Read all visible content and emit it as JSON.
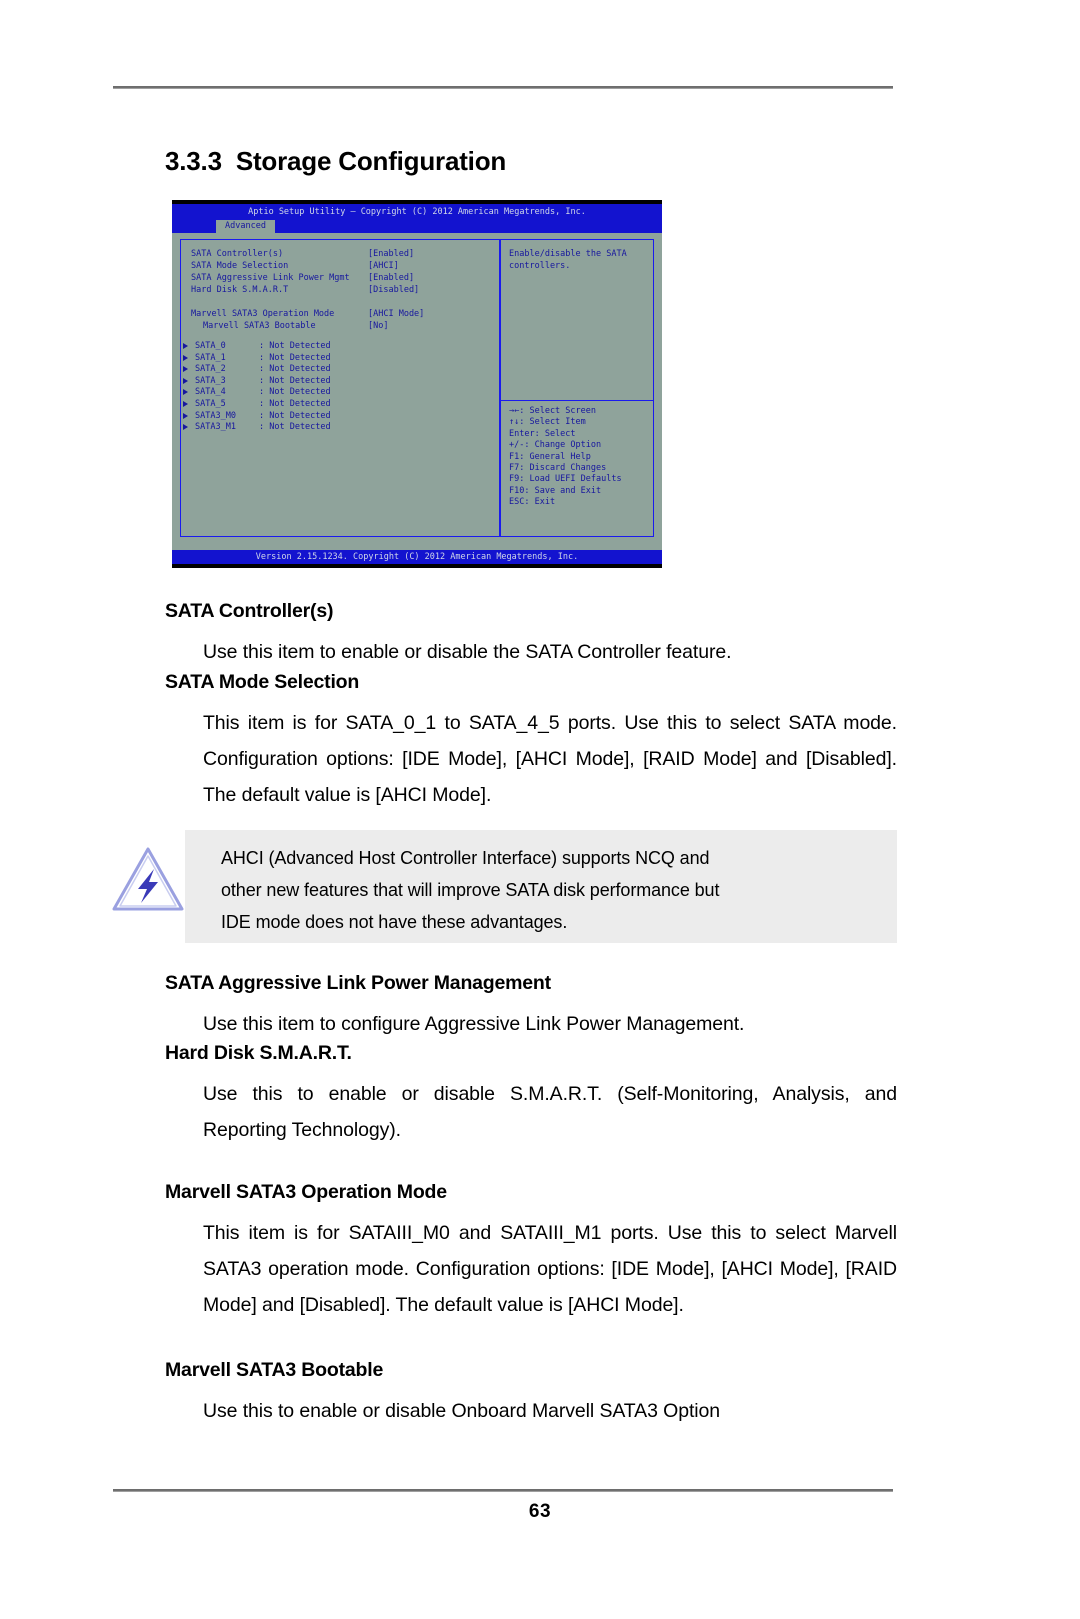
{
  "document": {
    "page_number": "63",
    "section_number": "3.3.3",
    "section_title": "Storage Configuration"
  },
  "bios": {
    "title": "Aptio Setup Utility – Copyright (C) 2012 American Megatrends, Inc.",
    "tab": "Advanced",
    "footer": "Version 2.15.1234. Copyright (C) 2012 American Megatrends, Inc.",
    "settings": [
      {
        "label": "SATA Controller(s)",
        "value": "[Enabled]",
        "indent": false
      },
      {
        "label": "SATA Mode Selection",
        "value": "[AHCI]",
        "indent": false
      },
      {
        "label": "SATA Aggressive Link Power Mgmt",
        "value": "[Enabled]",
        "indent": false
      },
      {
        "label": "Hard Disk S.M.A.R.T",
        "value": "[Disabled]",
        "indent": false
      },
      {
        "label": "Marvell SATA3 Operation Mode",
        "value": "[AHCI Mode]",
        "indent": false
      },
      {
        "label": "Marvell SATA3 Bootable",
        "value": "[No]",
        "indent": true
      }
    ],
    "devices": [
      {
        "name": "SATA_0",
        "status": ": Not Detected"
      },
      {
        "name": "SATA_1",
        "status": ": Not Detected"
      },
      {
        "name": "SATA_2",
        "status": ": Not Detected"
      },
      {
        "name": "SATA_3",
        "status": ": Not Detected"
      },
      {
        "name": "SATA_4",
        "status": ": Not Detected"
      },
      {
        "name": "SATA_5",
        "status": ": Not Detected"
      },
      {
        "name": "SATA3_M0",
        "status": ": Not Detected"
      },
      {
        "name": "SATA3_M1",
        "status": ": Not Detected"
      }
    ],
    "help": "Enable/disable the SATA controllers.",
    "keys": [
      "→←: Select Screen",
      "↑↓: Select Item",
      "Enter: Select",
      "+/-: Change Option",
      "F1: General Help",
      "F7: Discard Changes",
      "F9: Load UEFI Defaults",
      "F10: Save and Exit",
      "ESC: Exit"
    ]
  },
  "content": {
    "sata_controllers": {
      "term": "SATA Controller(s)",
      "body": "Use this item to enable or disable the SATA Controller feature."
    },
    "sata_mode_selection": {
      "term": "SATA Mode Selection",
      "body": "This item is for SATA_0_1 to SATA_4_5 ports. Use this to select SATA mode. Configuration options: [IDE Mode], [AHCI Mode], [RAID Mode] and [Disabled]. The default value is [AHCI Mode]."
    },
    "note": {
      "line1": "AHCI (Advanced Host Controller Interface) supports NCQ and",
      "line2": "other new features that will improve SATA disk performance but",
      "line3": "IDE mode does not have these advantages."
    },
    "sata_alpm": {
      "term": "SATA Aggressive Link Power Management",
      "body": "Use this item to configure Aggressive Link Power Management."
    },
    "hard_disk_smart": {
      "term": "Hard Disk S.M.A.R.T.",
      "body": "Use this to enable or disable S.M.A.R.T. (Self-Monitoring, Analysis, and Reporting Technology)."
    },
    "marvell_operation_mode": {
      "term": "Marvell SATA3 Operation Mode",
      "body": "This item is for SATAIII_M0 and SATAIII_M1 ports. Use this to select Marvell SATA3 operation mode. Configuration options: [IDE Mode], [AHCI Mode], [RAID Mode] and [Disabled]. The default value is [AHCI Mode]."
    },
    "marvell_bootable": {
      "term": "Marvell SATA3 Bootable",
      "body": "Use this to enable or disable Onboard Marvell SATA3 Option"
    }
  },
  "colors": {
    "bios_blue": "#1313cf",
    "bios_bg": "#8fa39b",
    "bios_text": "#17179e",
    "note_bg": "#ececec",
    "rule": "#6d6d6d"
  }
}
